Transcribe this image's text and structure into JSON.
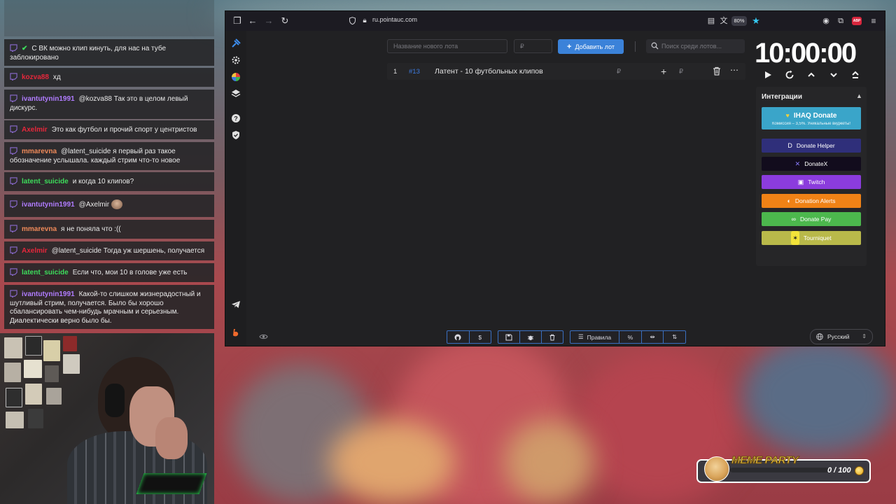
{
  "chat": {
    "top_faded": "",
    "messages": [
      {
        "user": "",
        "text": "С ВК можно клип кинуть, для нас на тубе заблокировано",
        "color": "#b07cff"
      },
      {
        "user": "kozva88",
        "text": "хд",
        "color": "#e6273b"
      },
      {
        "user": "ivantutynin1991",
        "text": "@kozva88 Так это в целом левый дискурс.",
        "color": "#b07cff"
      },
      {
        "user": "Axelmir",
        "text": "Это как футбол и прочий спорт у центристов",
        "color": "#e6273b"
      },
      {
        "user": "mmarevna",
        "text": "@latent_suicide я первый раз такое обозначение услышала. каждый стрим что-то новое",
        "color": "#f08a5a"
      },
      {
        "user": "latent_suicide",
        "text": "и когда 10 клипов?",
        "color": "#3ddc5b"
      },
      {
        "user": "ivantutynin1991",
        "text": "@Axelmir",
        "color": "#b07cff"
      },
      {
        "user": "mmarevna",
        "text": "я не поняла что :((",
        "color": "#f08a5a"
      },
      {
        "user": "Axelmir",
        "text": "@latent_suicide Тогда уж шершень, получается",
        "color": "#e6273b"
      },
      {
        "user": "latent_suicide",
        "text": "Если что, мои 10 в голове уже есть",
        "color": "#3ddc5b"
      },
      {
        "user": "ivantutynin1991",
        "text": "Какой-то слишком жизнерадостный и шутливый стрим, получается. Было бы хорошо сбалансировать чем-нибудь мрачным и серьезным. Диалектически верно было бы.",
        "color": "#b07cff"
      }
    ]
  },
  "browser": {
    "url": "ru.pointauc.com",
    "zoom": "80%",
    "abp_label": "ABP"
  },
  "auction": {
    "lot_name_placeholder": "Название нового лота",
    "price_placeholder": "₽",
    "add_button_label": "Добавить лот",
    "search_placeholder": "Поиск среди лотов...",
    "lots": [
      {
        "position": "1",
        "id": "#13",
        "name": "Латент - 10 футбольных клипов",
        "currency": "₽"
      }
    ]
  },
  "timer": {
    "value": "10:00:00"
  },
  "integrations": {
    "title": "Интеграции",
    "ihaq_title": "IHAQ Donate",
    "ihaq_subtitle": "Комиссия – 3,5%. Уникальные виджеты!",
    "items": [
      {
        "label": "Donate Helper",
        "color": "#2f2f7a"
      },
      {
        "label": "DonateX",
        "color": "#120c1d"
      },
      {
        "label": "Twitch",
        "color": "#8b3cdd"
      },
      {
        "label": "Donation Alerts",
        "color": "#f08216"
      },
      {
        "label": "Donate Pay",
        "color": "#4cb84d"
      },
      {
        "label": "Tourniquet",
        "color": "#b9b94a"
      }
    ],
    "ihaq_color": "#3aa5c9"
  },
  "bottom_bar": {
    "rules_label": "Правила"
  },
  "language": {
    "selected": "Русский"
  },
  "meme_party": {
    "title": "MEME PARTY",
    "count_text": "0 / 100",
    "progress": 0
  }
}
